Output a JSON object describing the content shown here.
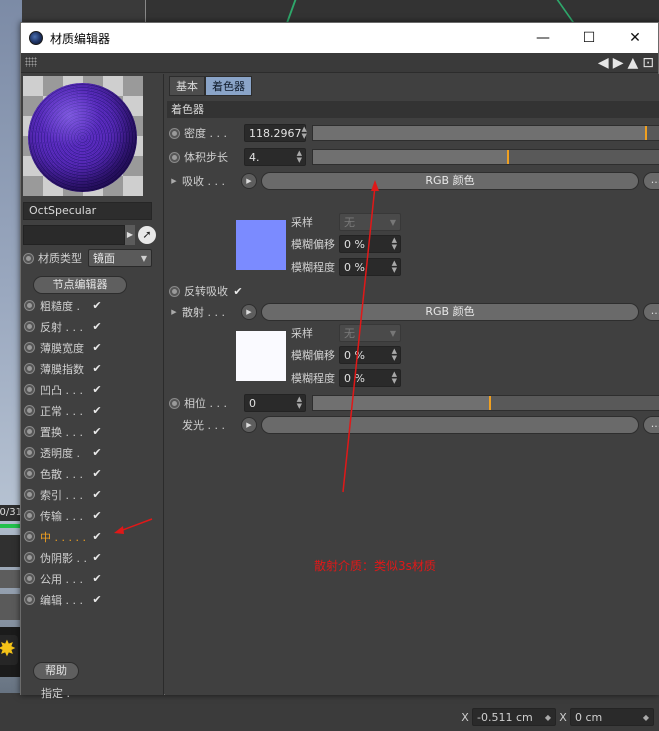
{
  "window": {
    "title": "材质编辑器",
    "minimize_glyph": "—",
    "maximize_glyph": "☐",
    "close_glyph": "✕",
    "nav_back_glyph": "◀",
    "nav_fwd_glyph": "▶",
    "nav_up_glyph": "▲",
    "lock_glyph": "⊡"
  },
  "background": {
    "timeline_text": "0/31",
    "coords": {
      "x_label": "X",
      "x_value": "-0.511 cm",
      "x2_label": "X",
      "x2_value": "0 cm"
    }
  },
  "material": {
    "name": "OctSpecular",
    "type_label": "材质类型",
    "type_value": "镜面",
    "node_editor_label": "节点编辑器",
    "help_label": "帮助",
    "assign_label": "指定 ."
  },
  "channels": [
    {
      "label": "粗糙度 .",
      "checked": true,
      "active": false
    },
    {
      "label": "反射 . . .",
      "checked": true,
      "active": false
    },
    {
      "label": "薄膜宽度",
      "checked": true,
      "active": false
    },
    {
      "label": "薄膜指数",
      "checked": true,
      "active": false
    },
    {
      "label": "凹凸 . . .",
      "checked": true,
      "active": false
    },
    {
      "label": "正常 . . .",
      "checked": true,
      "active": false
    },
    {
      "label": "置换 . . .",
      "checked": true,
      "active": false
    },
    {
      "label": "透明度 .",
      "checked": true,
      "active": false
    },
    {
      "label": "色散 . . .",
      "checked": true,
      "active": false
    },
    {
      "label": "索引 . . .",
      "checked": true,
      "active": false
    },
    {
      "label": "传输 . . .",
      "checked": true,
      "active": false
    },
    {
      "label": "中 . . . . .",
      "checked": true,
      "active": true
    },
    {
      "label": "伪阴影 . .",
      "checked": true,
      "active": false
    },
    {
      "label": "公用 . . .",
      "checked": true,
      "active": false
    },
    {
      "label": "编辑 . . .",
      "checked": true,
      "active": false
    }
  ],
  "tabs": [
    {
      "label": "基本",
      "active": false
    },
    {
      "label": "着色器",
      "active": true
    }
  ],
  "shader": {
    "section_title": "着色器",
    "density": {
      "label": "密度 . . .",
      "value": "118.2967",
      "slider_fraction": 0.94
    },
    "step_length": {
      "label": "体积步长",
      "value": "4.",
      "slider_fraction": 0.55
    },
    "absorption": {
      "label": "吸收 . . .",
      "button_label": "RGB 颜色",
      "more_label": "...",
      "color": "#7b8bff",
      "sampling_label": "采样",
      "sampling_value": "无",
      "blur_offset_label": "模糊偏移",
      "blur_offset_value": "0 %",
      "blur_amount_label": "模糊程度",
      "blur_amount_value": "0 %"
    },
    "invert_absorption": {
      "label": "反转吸收",
      "checked": true
    },
    "scattering": {
      "label": "散射 . . .",
      "button_label": "RGB 颜色",
      "more_label": "...",
      "color": "#fafaff",
      "sampling_label": "采样",
      "sampling_value": "无",
      "blur_offset_label": "模糊偏移",
      "blur_offset_value": "0 %",
      "blur_amount_label": "模糊程度",
      "blur_amount_value": "0 %"
    },
    "phase": {
      "label": "相位 . . .",
      "value": "0",
      "slider_fraction": 0.5
    },
    "emission": {
      "label": "发光 . . .",
      "more_label": "..."
    }
  },
  "annotation": {
    "text": "散射介质：类似3s材质",
    "color": "#e01818"
  }
}
